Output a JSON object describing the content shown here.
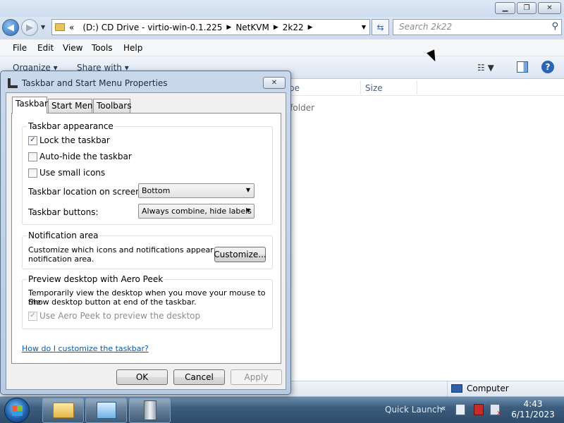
{
  "explorer": {
    "breadcrumb": [
      "«",
      "(D:) CD Drive - virtio-win-0.1.225",
      "NetKVM",
      "2k22"
    ],
    "search_placeholder": "Search 2k22",
    "menu": [
      "File",
      "Edit",
      "View",
      "Tools",
      "Help"
    ],
    "commands": {
      "organize": "Organize ▾",
      "share_with": "Share with ▾"
    },
    "columns": [
      "pe",
      "Size"
    ],
    "empty_message": "e folder",
    "status": "Computer"
  },
  "dialog": {
    "title": "Taskbar and Start Menu Properties",
    "tabs": [
      "Taskbar",
      "Start Menu",
      "Toolbars"
    ],
    "appearance": {
      "heading": "Taskbar appearance",
      "lock_label": "Lock the taskbar",
      "lock_checked": true,
      "autohide_label": "Auto-hide the taskbar",
      "autohide_checked": false,
      "small_icons_label": "Use small icons",
      "small_icons_checked": false,
      "location_label": "Taskbar location on screen:",
      "location_value": "Bottom",
      "buttons_label": "Taskbar buttons:",
      "buttons_value": "Always combine, hide labels"
    },
    "notification": {
      "heading": "Notification area",
      "text_line1": "Customize which icons and notifications appear in the",
      "text_line2": "notification area.",
      "customize_button": "Customize..."
    },
    "peek": {
      "heading": "Preview desktop with Aero Peek",
      "text_line1": "Temporarily view the desktop when you move your mouse to the",
      "text_line2": "Show desktop button at end of the taskbar.",
      "checkbox_label": "Use Aero Peek to preview the desktop",
      "checkbox_checked": true,
      "checkbox_disabled": true
    },
    "help_link": "How do I customize the taskbar?",
    "buttons": {
      "ok": "OK",
      "cancel": "Cancel",
      "apply": "Apply"
    }
  },
  "taskbar": {
    "quick_launch": "Quick Launch",
    "chevron": "«",
    "clock_time": "4:43",
    "clock_date": "6/11/2023"
  },
  "icons": {
    "check": "✓",
    "close": "✕",
    "dropdown": "▼"
  }
}
